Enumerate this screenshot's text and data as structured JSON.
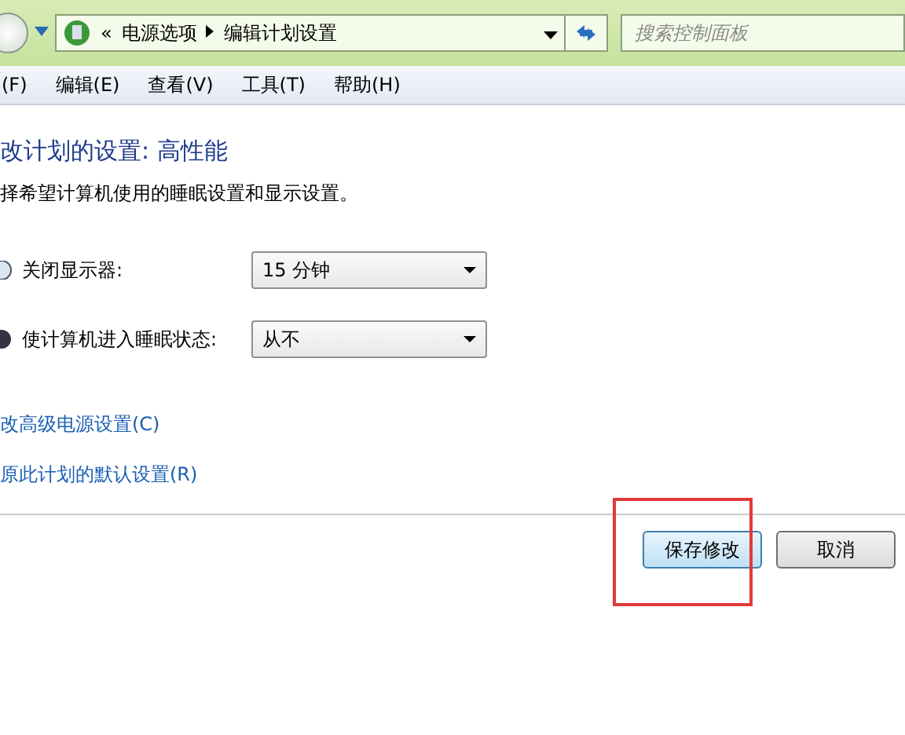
{
  "address_bar": {
    "path": [
      "电源选项",
      "编辑计划设置"
    ],
    "overflow": "«"
  },
  "search": {
    "placeholder": "搜索控制面板"
  },
  "menu": [
    "(F)",
    "编辑(E)",
    "查看(V)",
    "工具(T)",
    "帮助(H)"
  ],
  "title": "改计划的设置: 高性能",
  "subtitle": "择希望计算机使用的睡眠设置和显示设置。",
  "settings": [
    {
      "kind": "display",
      "label": "关闭显示器:",
      "value": "15 分钟"
    },
    {
      "kind": "sleep",
      "label": "使计算机进入睡眠状态:",
      "value": "从不"
    }
  ],
  "links": [
    "改高级电源设置(C)",
    "原此计划的默认设置(R)"
  ],
  "buttons": [
    {
      "label": "保存修改",
      "highlighted": true
    },
    {
      "label": "取消",
      "highlighted": false
    }
  ]
}
